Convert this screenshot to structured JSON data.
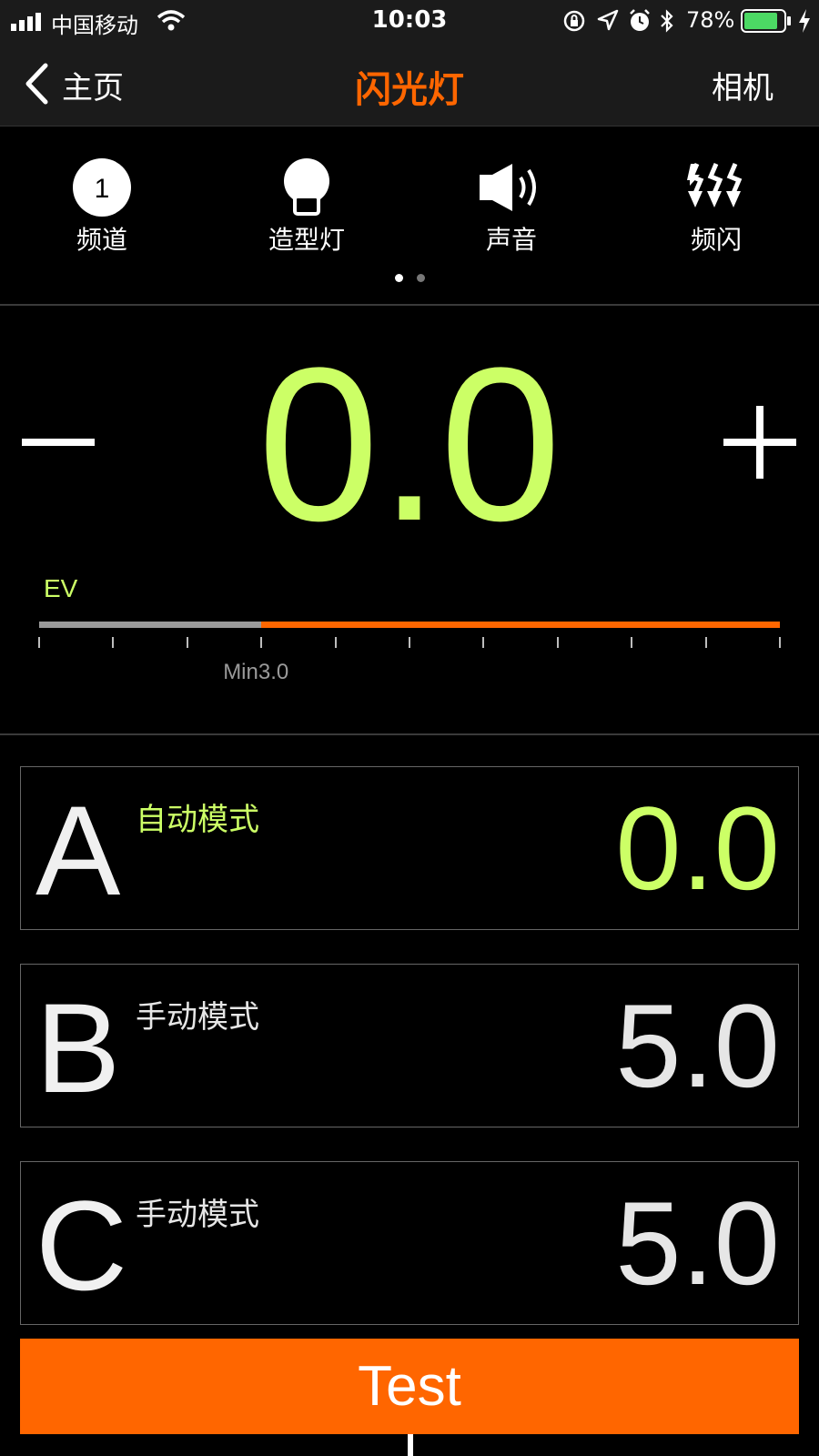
{
  "status_bar": {
    "carrier": "中国移动",
    "time": "10:03",
    "battery_percent": "78%"
  },
  "nav": {
    "back_label": "主页",
    "title": "闪光灯",
    "right_label": "相机"
  },
  "features": [
    {
      "label": "频道",
      "icon": "channel-icon",
      "badge": "1"
    },
    {
      "label": "造型灯",
      "icon": "modeling-lamp-icon"
    },
    {
      "label": "声音",
      "icon": "speaker-icon"
    },
    {
      "label": "频闪",
      "icon": "multi-flash-icon"
    }
  ],
  "page_indicator": {
    "pages": 2,
    "current": 1
  },
  "ev": {
    "value": "0.0",
    "unit": "EV",
    "min_label": "Min3.0",
    "slider_fraction": 0.3
  },
  "groups": [
    {
      "letter": "A",
      "mode": "自动模式",
      "value": "0.0",
      "active": true
    },
    {
      "letter": "B",
      "mode": "手动模式",
      "value": "5.0",
      "active": false
    },
    {
      "letter": "C",
      "mode": "手动模式",
      "value": "5.0",
      "active": false
    }
  ],
  "test_button": {
    "label": "Test"
  },
  "colors": {
    "accent": "#ff6600",
    "value_green": "#ccff66",
    "inactive_text": "#e6e6e6",
    "battery": "#4cd964"
  }
}
